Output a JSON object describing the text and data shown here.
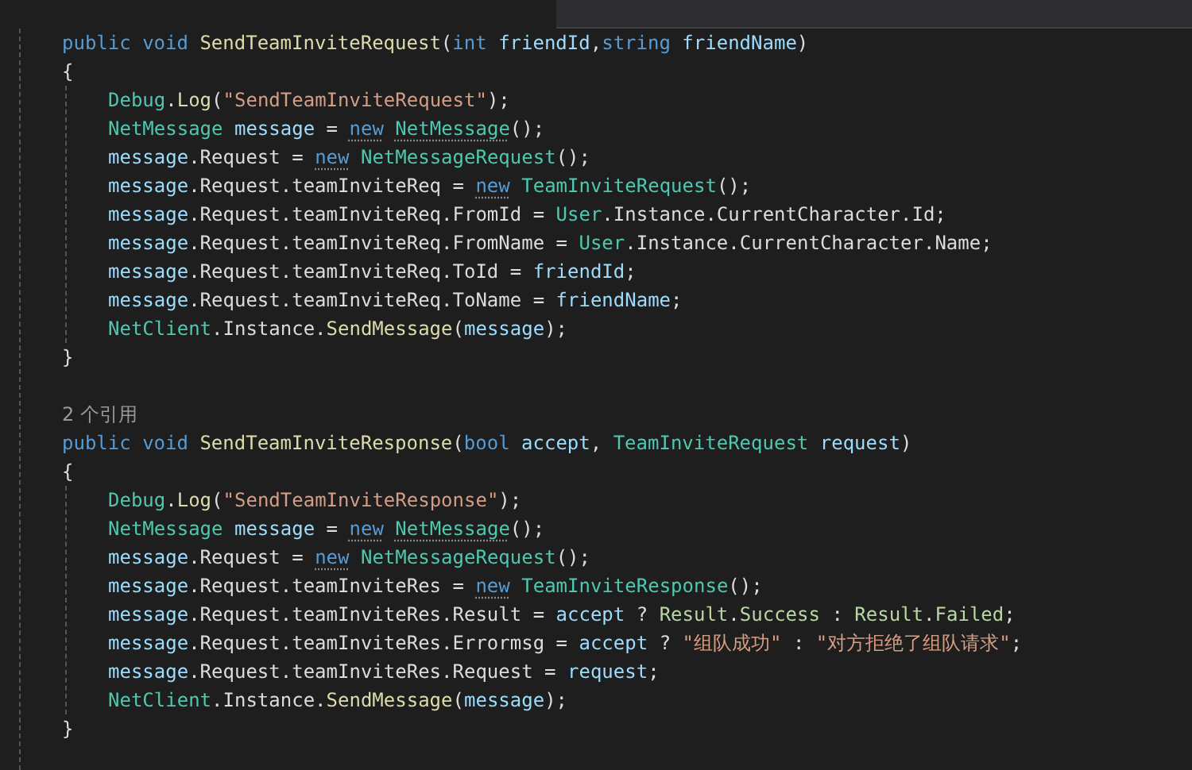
{
  "methods": [
    {
      "signature": [
        {
          "text": "public void ",
          "kind": "keyword"
        },
        {
          "text": "SendTeamInviteRequest",
          "kind": "method"
        },
        {
          "text": "(",
          "kind": "plain"
        },
        {
          "text": "int ",
          "kind": "keyword"
        },
        {
          "text": "friendId",
          "kind": "param"
        },
        {
          "text": ",",
          "kind": "plain"
        },
        {
          "text": "string ",
          "kind": "keyword"
        },
        {
          "text": "friendName",
          "kind": "param"
        },
        {
          "text": ")",
          "kind": "plain"
        }
      ],
      "open_brace": "{",
      "body": [
        [
          {
            "text": "Debug",
            "kind": "type"
          },
          {
            "text": ".",
            "kind": "plain"
          },
          {
            "text": "Log",
            "kind": "method"
          },
          {
            "text": "(",
            "kind": "plain"
          },
          {
            "text": "\"SendTeamInviteRequest\"",
            "kind": "string"
          },
          {
            "text": ");",
            "kind": "plain"
          }
        ],
        [
          {
            "text": "NetMessage ",
            "kind": "type"
          },
          {
            "text": "message",
            "kind": "param"
          },
          {
            "text": " = ",
            "kind": "plain"
          },
          {
            "text": "new",
            "kind": "keyword",
            "suggestion": true
          },
          {
            "text": " NetMessage",
            "kind": "type",
            "suggestion": true
          },
          {
            "text": "();",
            "kind": "plain"
          }
        ],
        [
          {
            "text": "message",
            "kind": "param"
          },
          {
            "text": ".Request = ",
            "kind": "plain"
          },
          {
            "text": "new",
            "kind": "keyword",
            "suggestion": true
          },
          {
            "text": " NetMessageRequest",
            "kind": "type"
          },
          {
            "text": "();",
            "kind": "plain"
          }
        ],
        [
          {
            "text": "message",
            "kind": "param"
          },
          {
            "text": ".Request.teamInviteReq = ",
            "kind": "plain"
          },
          {
            "text": "new",
            "kind": "keyword",
            "suggestion": true
          },
          {
            "text": " TeamInviteRequest",
            "kind": "type"
          },
          {
            "text": "();",
            "kind": "plain"
          }
        ],
        [
          {
            "text": "message",
            "kind": "param"
          },
          {
            "text": ".Request.teamInviteReq.FromId = ",
            "kind": "plain"
          },
          {
            "text": "User",
            "kind": "type"
          },
          {
            "text": ".Instance.CurrentCharacter.Id;",
            "kind": "plain"
          }
        ],
        [
          {
            "text": "message",
            "kind": "param"
          },
          {
            "text": ".Request.teamInviteReq.FromName = ",
            "kind": "plain"
          },
          {
            "text": "User",
            "kind": "type"
          },
          {
            "text": ".Instance.CurrentCharacter.Name;",
            "kind": "plain"
          }
        ],
        [
          {
            "text": "message",
            "kind": "param"
          },
          {
            "text": ".Request.teamInviteReq.ToId = ",
            "kind": "plain"
          },
          {
            "text": "friendId",
            "kind": "param"
          },
          {
            "text": ";",
            "kind": "plain"
          }
        ],
        [
          {
            "text": "message",
            "kind": "param"
          },
          {
            "text": ".Request.teamInviteReq.ToName = ",
            "kind": "plain"
          },
          {
            "text": "friendName",
            "kind": "param"
          },
          {
            "text": ";",
            "kind": "plain"
          }
        ],
        [
          {
            "text": "NetClient",
            "kind": "type"
          },
          {
            "text": ".Instance.",
            "kind": "plain"
          },
          {
            "text": "SendMessage",
            "kind": "method"
          },
          {
            "text": "(",
            "kind": "plain"
          },
          {
            "text": "message",
            "kind": "param"
          },
          {
            "text": ");",
            "kind": "plain"
          }
        ]
      ],
      "close_brace": "}"
    },
    {
      "references": "2 个引用",
      "signature": [
        {
          "text": "public void ",
          "kind": "keyword"
        },
        {
          "text": "SendTeamInviteResponse",
          "kind": "method"
        },
        {
          "text": "(",
          "kind": "plain"
        },
        {
          "text": "bool ",
          "kind": "keyword"
        },
        {
          "text": "accept",
          "kind": "param"
        },
        {
          "text": ", ",
          "kind": "plain"
        },
        {
          "text": "TeamInviteRequest ",
          "kind": "type"
        },
        {
          "text": "request",
          "kind": "param"
        },
        {
          "text": ")",
          "kind": "plain"
        }
      ],
      "open_brace": "{",
      "body": [
        [
          {
            "text": "Debug",
            "kind": "type"
          },
          {
            "text": ".",
            "kind": "plain"
          },
          {
            "text": "Log",
            "kind": "method"
          },
          {
            "text": "(",
            "kind": "plain"
          },
          {
            "text": "\"SendTeamInviteResponse\"",
            "kind": "string"
          },
          {
            "text": ");",
            "kind": "plain"
          }
        ],
        [
          {
            "text": "NetMessage ",
            "kind": "type"
          },
          {
            "text": "message",
            "kind": "param"
          },
          {
            "text": " = ",
            "kind": "plain"
          },
          {
            "text": "new",
            "kind": "keyword",
            "suggestion": true
          },
          {
            "text": " NetMessage",
            "kind": "type",
            "suggestion": true
          },
          {
            "text": "();",
            "kind": "plain"
          }
        ],
        [
          {
            "text": "message",
            "kind": "param"
          },
          {
            "text": ".Request = ",
            "kind": "plain"
          },
          {
            "text": "new",
            "kind": "keyword",
            "suggestion": true
          },
          {
            "text": " NetMessageRequest",
            "kind": "type"
          },
          {
            "text": "();",
            "kind": "plain"
          }
        ],
        [
          {
            "text": "message",
            "kind": "param"
          },
          {
            "text": ".Request.teamInviteRes = ",
            "kind": "plain"
          },
          {
            "text": "new",
            "kind": "keyword",
            "suggestion": true
          },
          {
            "text": " TeamInviteResponse",
            "kind": "type"
          },
          {
            "text": "();",
            "kind": "plain"
          }
        ],
        [
          {
            "text": "message",
            "kind": "param"
          },
          {
            "text": ".Request.teamInviteRes.Result = ",
            "kind": "plain"
          },
          {
            "text": "accept",
            "kind": "param"
          },
          {
            "text": " ? ",
            "kind": "plain"
          },
          {
            "text": "Result",
            "kind": "enum"
          },
          {
            "text": ".",
            "kind": "plain"
          },
          {
            "text": "Success",
            "kind": "enum"
          },
          {
            "text": " : ",
            "kind": "plain"
          },
          {
            "text": "Result",
            "kind": "enum"
          },
          {
            "text": ".",
            "kind": "plain"
          },
          {
            "text": "Failed",
            "kind": "enum"
          },
          {
            "text": ";",
            "kind": "plain"
          }
        ],
        [
          {
            "text": "message",
            "kind": "param"
          },
          {
            "text": ".Request.teamInviteRes.Errormsg = ",
            "kind": "plain"
          },
          {
            "text": "accept",
            "kind": "param"
          },
          {
            "text": " ? ",
            "kind": "plain"
          },
          {
            "text": "\"组队成功\"",
            "kind": "string"
          },
          {
            "text": " : ",
            "kind": "plain"
          },
          {
            "text": "\"对方拒绝了组队请求\"",
            "kind": "string"
          },
          {
            "text": ";",
            "kind": "plain"
          }
        ],
        [
          {
            "text": "message",
            "kind": "param"
          },
          {
            "text": ".Request.teamInviteRes.Request = ",
            "kind": "plain"
          },
          {
            "text": "request",
            "kind": "param"
          },
          {
            "text": ";",
            "kind": "plain"
          }
        ],
        [
          {
            "text": "NetClient",
            "kind": "type"
          },
          {
            "text": ".Instance.",
            "kind": "plain"
          },
          {
            "text": "SendMessage",
            "kind": "method"
          },
          {
            "text": "(",
            "kind": "plain"
          },
          {
            "text": "message",
            "kind": "param"
          },
          {
            "text": ");",
            "kind": "plain"
          }
        ]
      ],
      "close_brace": "}"
    }
  ]
}
